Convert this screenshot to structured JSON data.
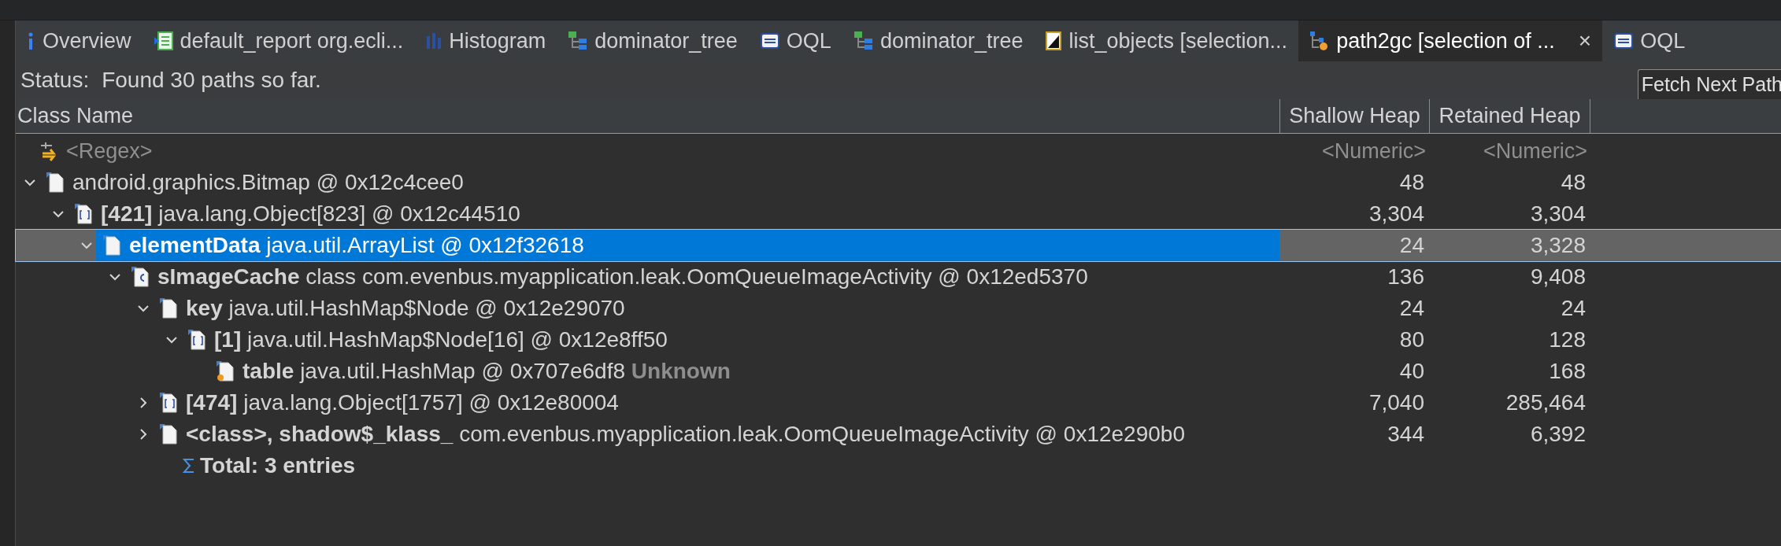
{
  "tabs": [
    {
      "label": "Overview",
      "kind": "info",
      "selected": false
    },
    {
      "label": "default_report org.ecli...",
      "kind": "report",
      "selected": false
    },
    {
      "label": "Histogram",
      "kind": "histogram",
      "selected": false
    },
    {
      "label": "dominator_tree",
      "kind": "tree",
      "selected": false
    },
    {
      "label": "OQL",
      "kind": "oql",
      "selected": false
    },
    {
      "label": "dominator_tree",
      "kind": "tree",
      "selected": false
    },
    {
      "label": "list_objects [selection...",
      "kind": "list",
      "selected": false
    },
    {
      "label": "path2gc [selection of ...",
      "kind": "path",
      "selected": true,
      "close": "×"
    },
    {
      "label": "OQL",
      "kind": "oql",
      "selected": false
    }
  ],
  "status": {
    "label": "Status:",
    "text": "Found 30 paths so far."
  },
  "fetch_button": "Fetch Next Path",
  "table": {
    "columns": [
      "Class Name",
      "Shallow Heap",
      "Retained Heap"
    ],
    "filters": [
      "<Regex>",
      "<Numeric>",
      "<Numeric>"
    ],
    "rows": [
      {
        "name": "",
        "text": "android.graphics.Bitmap @ 0x12c4cee0",
        "kind": "object",
        "expanded": true,
        "selected": false,
        "shallow": "48",
        "retained": "48",
        "children": [
          {
            "name": "[421]",
            "text": "java.lang.Object[823] @ 0x12c44510",
            "kind": "array",
            "expanded": true,
            "selected": false,
            "shallow": "3,304",
            "retained": "3,304",
            "children": [
              {
                "name": "elementData",
                "text": "java.util.ArrayList @ 0x12f32618",
                "kind": "object",
                "expanded": true,
                "selected": true,
                "shallow": "24",
                "retained": "3,328",
                "children": [
                  {
                    "name": "sImageCache",
                    "text": "class com.evenbus.myapplication.leak.OomQueueImageActivity @ 0x12ed5370",
                    "kind": "class",
                    "expanded": true,
                    "selected": false,
                    "shallow": "136",
                    "retained": "9,408",
                    "children": [
                      {
                        "name": "key",
                        "text": "java.util.HashMap$Node @ 0x12e29070",
                        "kind": "object",
                        "expanded": true,
                        "selected": false,
                        "shallow": "24",
                        "retained": "24",
                        "children": [
                          {
                            "name": "[1]",
                            "text": "java.util.HashMap$Node[16] @ 0x12e8ff50",
                            "kind": "array",
                            "expanded": true,
                            "selected": false,
                            "shallow": "80",
                            "retained": "128",
                            "children": [
                              {
                                "name": "table",
                                "text": "java.util.HashMap @ 0x707e6df8",
                                "suffix": "Unknown",
                                "kind": "root",
                                "selected": false,
                                "shallow": "40",
                                "retained": "168"
                              }
                            ]
                          }
                        ]
                      },
                      {
                        "name": "[474]",
                        "text": "java.lang.Object[1757] @ 0x12e80004",
                        "kind": "array",
                        "expanded": false,
                        "selected": false,
                        "shallow": "7,040",
                        "retained": "285,464"
                      },
                      {
                        "name": "<class>, shadow$_klass_",
                        "text": "com.evenbus.myapplication.leak.OomQueueImageActivity @ 0x12e290b0",
                        "kind": "object",
                        "expanded": false,
                        "selected": false,
                        "shallow": "344",
                        "retained": "6,392"
                      }
                    ],
                    "total": "Total: 3 entries"
                  }
                ]
              }
            ]
          }
        ]
      }
    ]
  }
}
